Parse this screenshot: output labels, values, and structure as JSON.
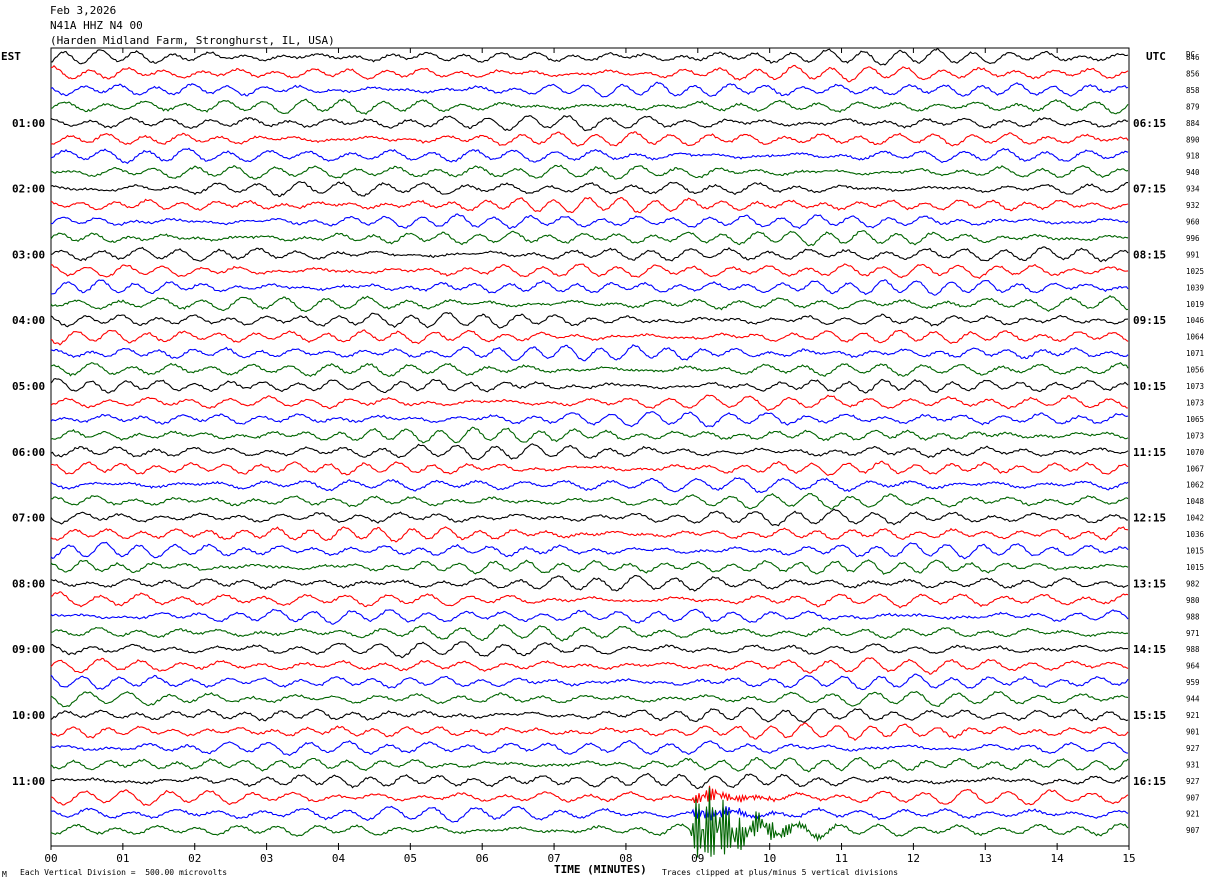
{
  "header": {
    "date": "Feb 3,2026",
    "station": "N41A HHZ N4 00",
    "location": "(Harden Midland Farm, Stronghurst, IL, USA)"
  },
  "left_tz": "EST",
  "right_tz": "UTC",
  "dc_label": "DC",
  "footer": {
    "scale": "Each Vertical Division =  500.00 microvolts",
    "xlabel": "TIME (MINUTES)",
    "clip": "Traces clipped at plus/minus 5 vertical divisions",
    "corner": "M"
  },
  "chart_data": {
    "type": "line",
    "title": "",
    "xlabel": "TIME (MINUTES)",
    "ylabel": "",
    "xlim": [
      0,
      15
    ],
    "x_ticks": [
      "00",
      "01",
      "02",
      "03",
      "04",
      "05",
      "06",
      "07",
      "08",
      "09",
      "10",
      "11",
      "12",
      "13",
      "14",
      "15"
    ],
    "rows": 48,
    "minutes_per_row": 15,
    "trace_colors": [
      "#000000",
      "#ff0000",
      "#0000ff",
      "#006400"
    ],
    "left_time_labels": [
      "01:00",
      "02:00",
      "03:00",
      "04:00",
      "05:00",
      "06:00",
      "07:00",
      "08:00",
      "09:00",
      "10:00",
      "11:00"
    ],
    "right_time_labels": [
      "06:15",
      "07:15",
      "08:15",
      "09:15",
      "10:15",
      "11:15",
      "12:15",
      "13:15",
      "14:15",
      "15:15",
      "16:15"
    ],
    "dc_offsets": [
      846,
      856,
      858,
      879,
      884,
      890,
      918,
      940,
      934,
      932,
      960,
      996,
      991,
      1025,
      1039,
      1019,
      1046,
      1064,
      1071,
      1056,
      1073,
      1073,
      1065,
      1073,
      1070,
      1067,
      1062,
      1048,
      1042,
      1036,
      1015,
      1015,
      982,
      980,
      988,
      971,
      988,
      964,
      959,
      944,
      921,
      901,
      927,
      931,
      927,
      907,
      921,
      907
    ],
    "event": {
      "row": 47,
      "start_minute": 8.9,
      "peak_minute": 9.0,
      "end_minute": 11.0
    },
    "clip_divisions": 5,
    "vertical_division_microvolts": 500.0
  }
}
